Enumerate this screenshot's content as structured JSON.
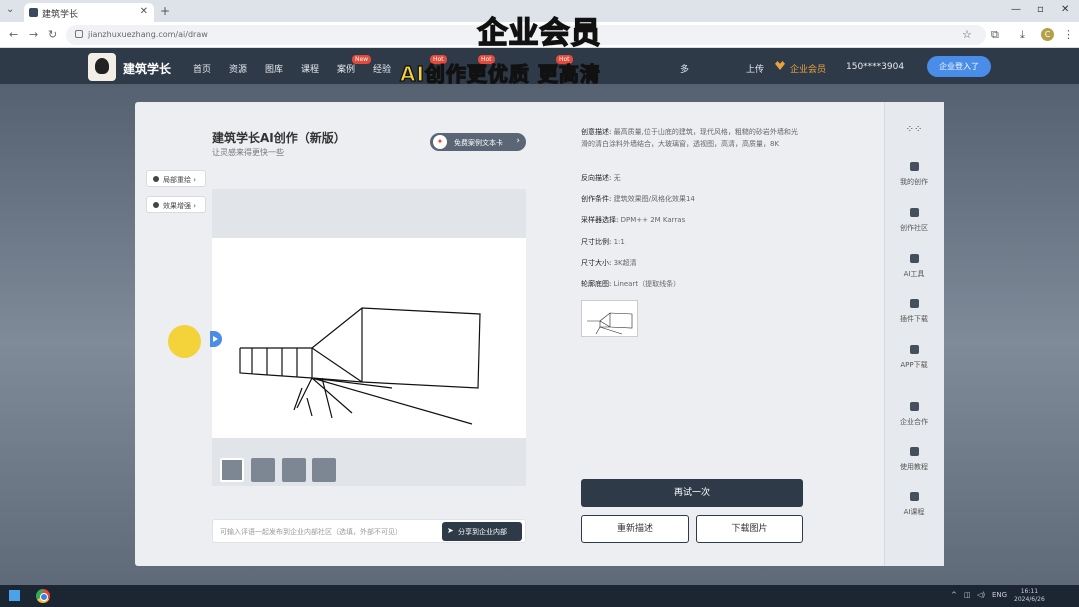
{
  "browser": {
    "tab_title": "建筑学长",
    "url": "jianzhuxuezhang.com/ai/draw"
  },
  "captions": {
    "top": "企业会员",
    "middle": "AI创作更优质 更高清"
  },
  "site": {
    "brand": "建筑学长",
    "nav": [
      {
        "label": "首页",
        "badge": ""
      },
      {
        "label": "资源",
        "badge": ""
      },
      {
        "label": "图库",
        "badge": ""
      },
      {
        "label": "课程",
        "badge": ""
      },
      {
        "label": "案例",
        "badge": "New"
      },
      {
        "label": "经验",
        "badge": ""
      },
      {
        "label": "AI绘",
        "badge": "Hot"
      },
      {
        "label": "",
        "badge": "Hot"
      },
      {
        "label": "",
        "badge": "Hot"
      },
      {
        "label": "多",
        "badge": ""
      }
    ],
    "upload": "上传",
    "vip": "企业会员",
    "phone": "150****3904",
    "enterprise_button": "企业登入了"
  },
  "panel": {
    "title": "建筑学长AI创作（新版）",
    "subtitle": "让灵感来得更快一些",
    "free_button": "免费案例文本卡",
    "side_buttons": [
      "局部重绘",
      "效果增强"
    ],
    "input_placeholder": "可输入评语一起发布到企业内部社区（选填，外部不可见）",
    "share_button": "分享到企业内部"
  },
  "details": [
    {
      "key": "创意描述:",
      "value": "最高质量,位于山底的建筑，现代风格，粗糙的砂岩外墙和光滑的清白涂料外墙结合，大玻璃窗，透视图，高清，高质量，8K"
    },
    {
      "key": "反向描述:",
      "value": "无"
    },
    {
      "key": "创作条件:",
      "value": "建筑效果图/风格化效果14"
    },
    {
      "key": "采样器选择:",
      "value": "DPM++ 2M Karras"
    },
    {
      "key": "尺寸比例:",
      "value": "1:1"
    },
    {
      "key": "尺寸大小:",
      "value": "3K超清"
    },
    {
      "key": "轮廓底图:",
      "value": "Lineart（提取线条）"
    }
  ],
  "actions": {
    "retry": "再试一次",
    "redescribe": "重新描述",
    "download": "下载图片"
  },
  "rail": [
    {
      "label": "我的创作",
      "icon": "grid-icon"
    },
    {
      "label": "创作社区",
      "icon": "chat-icon"
    },
    {
      "label": "AI工具",
      "icon": "toolbox-icon"
    },
    {
      "label": "插件下载",
      "icon": "puzzle-icon"
    },
    {
      "label": "APP下载",
      "icon": "android-icon"
    },
    {
      "label": "企业合作",
      "icon": "building-icon"
    },
    {
      "label": "使用教程",
      "icon": "book-icon"
    },
    {
      "label": "AI课程",
      "icon": "video-icon"
    }
  ],
  "taskbar": {
    "lang": "ENG",
    "time": "16:11",
    "date": "2024/6/26"
  }
}
